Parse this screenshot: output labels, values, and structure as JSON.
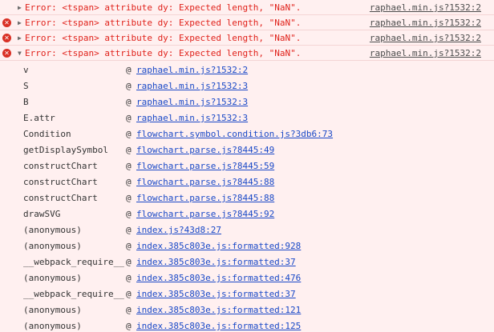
{
  "errors": [
    {
      "message": "Error: <tspan> attribute dy: Expected length, \"NaN\".",
      "source": "raphael.min.js?1532:2",
      "expanded": false,
      "icon": "triangle"
    },
    {
      "message": "Error: <tspan> attribute dy: Expected length, \"NaN\".",
      "source": "raphael.min.js?1532:2",
      "expanded": false,
      "icon": "error"
    },
    {
      "message": "Error: <tspan> attribute dy: Expected length, \"NaN\".",
      "source": "raphael.min.js?1532:2",
      "expanded": false,
      "icon": "error"
    },
    {
      "message": "Error: <tspan> attribute dy: Expected length, \"NaN\".",
      "source": "raphael.min.js?1532:2",
      "expanded": true,
      "icon": "error"
    }
  ],
  "at_symbol": "@",
  "stack": [
    {
      "fn": "v",
      "loc": "raphael.min.js?1532:2"
    },
    {
      "fn": "S",
      "loc": "raphael.min.js?1532:3"
    },
    {
      "fn": "B",
      "loc": "raphael.min.js?1532:3"
    },
    {
      "fn": "E.attr",
      "loc": "raphael.min.js?1532:3"
    },
    {
      "fn": "Condition",
      "loc": "flowchart.symbol.condition.js?3db6:73"
    },
    {
      "fn": "getDisplaySymbol",
      "loc": "flowchart.parse.js?8445:49"
    },
    {
      "fn": "constructChart",
      "loc": "flowchart.parse.js?8445:59"
    },
    {
      "fn": "constructChart",
      "loc": "flowchart.parse.js?8445:88"
    },
    {
      "fn": "constructChart",
      "loc": "flowchart.parse.js?8445:88"
    },
    {
      "fn": "drawSVG",
      "loc": "flowchart.parse.js?8445:92"
    },
    {
      "fn": "(anonymous)",
      "loc": "index.js?43d8:27"
    },
    {
      "fn": "(anonymous)",
      "loc": "index.385c803e.js:formatted:928"
    },
    {
      "fn": "__webpack_require__",
      "loc": "index.385c803e.js:formatted:37"
    },
    {
      "fn": "(anonymous)",
      "loc": "index.385c803e.js:formatted:476"
    },
    {
      "fn": "__webpack_require__",
      "loc": "index.385c803e.js:formatted:37"
    },
    {
      "fn": "(anonymous)",
      "loc": "index.385c803e.js:formatted:121"
    },
    {
      "fn": "(anonymous)",
      "loc": "index.385c803e.js:formatted:125"
    }
  ],
  "colors": {
    "error_text": "#e0221b",
    "link": "#1a49c7",
    "background": "#fff0f0"
  }
}
